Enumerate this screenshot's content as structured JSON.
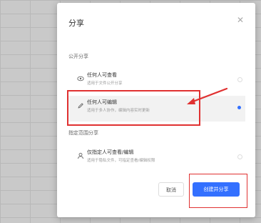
{
  "dialog": {
    "title": "分享",
    "close_icon": "close-icon"
  },
  "sections": {
    "public": {
      "label": "公开分享",
      "options": [
        {
          "title": "任何人可查看",
          "desc": "适用于文件公开分享",
          "icon": "eye-icon",
          "selected": false
        },
        {
          "title": "任何人可编辑",
          "desc": "适用于多人协作，编辑内容实时更新",
          "icon": "pencil-icon",
          "selected": true
        }
      ]
    },
    "restricted": {
      "label": "指定范围分享",
      "options": [
        {
          "title": "仅指定人可查看/编辑",
          "desc": "适用于隐私文件，可指定查看/编辑权限",
          "icon": "user-icon",
          "selected": false
        }
      ]
    }
  },
  "buttons": {
    "cancel": "取消",
    "create": "创建并分享"
  },
  "colors": {
    "accent": "#3370ff",
    "annotation": "#e03131"
  }
}
